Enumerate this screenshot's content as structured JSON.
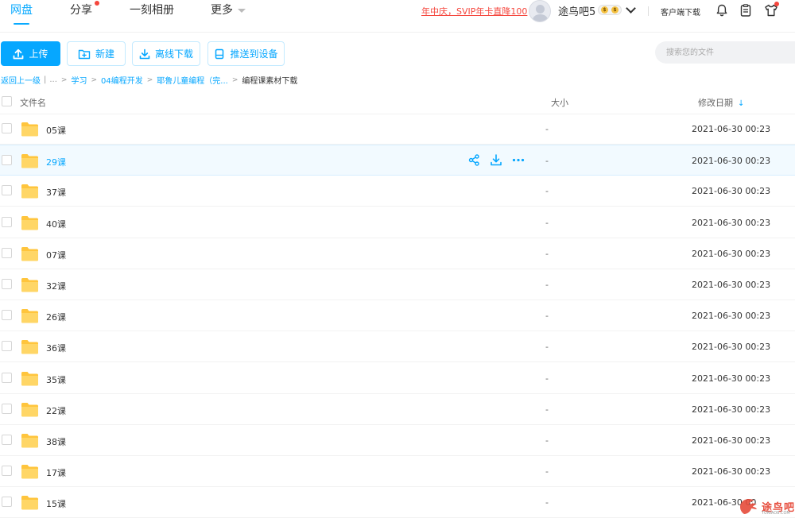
{
  "nav": {
    "tabs": [
      {
        "label": "网盘",
        "active": true
      },
      {
        "label": "分享",
        "badge_dot": true
      },
      {
        "label": "一刻相册"
      },
      {
        "label": "更多"
      }
    ],
    "promo": "年中庆，SVIP年卡直降100",
    "username": "途鸟吧5",
    "client_download": "客户端下载",
    "icons": [
      "bell-icon",
      "clipboard-icon",
      "shirt-icon"
    ]
  },
  "toolbar": {
    "upload": "上传",
    "new": "新建",
    "offline_download": "离线下载",
    "push_to_device": "推送到设备",
    "search_placeholder": "搜索您的文件"
  },
  "breadcrumb": {
    "back": "返回上一级",
    "ellipsis": "...",
    "items": [
      "学习",
      "04编程开发",
      "耶鲁儿童编程（完...",
      "编程课素材下载"
    ]
  },
  "table": {
    "headers": {
      "name": "文件名",
      "size": "大小",
      "date": "修改日期"
    },
    "rows": [
      {
        "name": "05课",
        "size": "-",
        "date": "2021-06-30 00:23"
      },
      {
        "name": "29课",
        "size": "-",
        "date": "2021-06-30 00:23",
        "hover": true
      },
      {
        "name": "37课",
        "size": "-",
        "date": "2021-06-30 00:23"
      },
      {
        "name": "40课",
        "size": "-",
        "date": "2021-06-30 00:23"
      },
      {
        "name": "07课",
        "size": "-",
        "date": "2021-06-30 00:23"
      },
      {
        "name": "32课",
        "size": "-",
        "date": "2021-06-30 00:23"
      },
      {
        "name": "26课",
        "size": "-",
        "date": "2021-06-30 00:23"
      },
      {
        "name": "36课",
        "size": "-",
        "date": "2021-06-30 00:23"
      },
      {
        "name": "35课",
        "size": "-",
        "date": "2021-06-30 00:23"
      },
      {
        "name": "22课",
        "size": "-",
        "date": "2021-06-30 00:23"
      },
      {
        "name": "38课",
        "size": "-",
        "date": "2021-06-30 00:23"
      },
      {
        "name": "17课",
        "size": "-",
        "date": "2021-06-30 00:23"
      },
      {
        "name": "15课",
        "size": "-",
        "date": "2021-06-30 00"
      }
    ]
  },
  "watermark": {
    "text": "途鸟吧",
    "sub": "TUNIAO8.COM"
  },
  "colors": {
    "accent": "#06a7ff",
    "promo": "#f5463d",
    "folder": "#ffc53d"
  }
}
